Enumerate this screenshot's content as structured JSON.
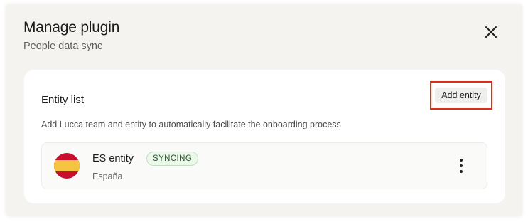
{
  "modal": {
    "title": "Manage plugin",
    "subtitle": "People data sync",
    "close_icon": "close-icon"
  },
  "entity_list": {
    "title": "Entity list",
    "add_button_label": "Add entity",
    "description": "Add Lucca team and entity to automatically facilitate the onboarding process",
    "items": [
      {
        "name": "ES entity",
        "status": "SYNCING",
        "country": "España",
        "flag_icon": "spain-flag-icon",
        "menu_icon": "kebab-menu-icon"
      }
    ]
  },
  "colors": {
    "modal_background": "#f4f3ef",
    "card_background": "#ffffff",
    "highlight_border": "#e02e12",
    "badge_background": "#edf8ed",
    "badge_border": "#bfe1bf",
    "flag_red": "#c8102e",
    "flag_yellow": "#f5c542"
  }
}
